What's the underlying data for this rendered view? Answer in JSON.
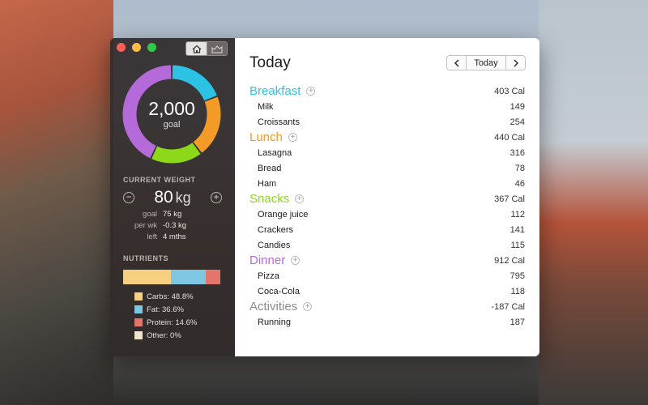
{
  "colors": {
    "breakfast": "#2cc2e4",
    "lunch": "#f39a27",
    "snacks": "#8ed81a",
    "dinner": "#b46ad8",
    "activities": "#8c8c8c",
    "carbs": "#f7cf80",
    "fat": "#7ec7e3",
    "protein": "#e3756a",
    "other": "#efe6c9"
  },
  "sidebar": {
    "toolbar": {
      "home_icon": "home-icon",
      "chart_icon": "chart-icon"
    },
    "goal": {
      "value": "2,000",
      "label": "goal"
    },
    "donut_segments": [
      {
        "meal": "breakfast",
        "calories": 403,
        "color": "#2cc2e4"
      },
      {
        "meal": "lunch",
        "calories": 440,
        "color": "#f39a27"
      },
      {
        "meal": "snacks",
        "calories": 367,
        "color": "#8ed81a"
      },
      {
        "meal": "dinner",
        "calories": 912,
        "color": "#b46ad8"
      }
    ],
    "weight": {
      "title": "CURRENT WEIGHT",
      "value": "80",
      "unit": "kg",
      "stats": [
        {
          "label": "goal",
          "value": "75 kg"
        },
        {
          "label": "per wk",
          "value": "-0.3 kg"
        },
        {
          "label": "left",
          "value": "4 mths"
        }
      ]
    },
    "nutrients": {
      "title": "NUTRIENTS",
      "items": [
        {
          "label": "Carbs: 48.8%",
          "percent": 48.8,
          "color": "#f7cf80"
        },
        {
          "label": "Fat: 36.6%",
          "percent": 36.6,
          "color": "#7ec7e3"
        },
        {
          "label": "Protein: 14.6%",
          "percent": 14.6,
          "color": "#e3756a"
        },
        {
          "label": "Other: 0%",
          "percent": 0,
          "color": "#efe6c9"
        }
      ]
    }
  },
  "main": {
    "title": "Today",
    "nav": {
      "prev": "‹",
      "today": "Today",
      "next": "›"
    },
    "meals": [
      {
        "name": "Breakfast",
        "total": "403 Cal",
        "color": "#2cc2e4",
        "items": [
          {
            "name": "Milk",
            "cal": "149"
          },
          {
            "name": "Croissants",
            "cal": "254"
          }
        ]
      },
      {
        "name": "Lunch",
        "total": "440 Cal",
        "color": "#f39a27",
        "items": [
          {
            "name": "Lasagna",
            "cal": "316"
          },
          {
            "name": "Bread",
            "cal": "78"
          },
          {
            "name": "Ham",
            "cal": "46"
          }
        ]
      },
      {
        "name": "Snacks",
        "total": "367 Cal",
        "color": "#8ed81a",
        "items": [
          {
            "name": "Orange juice",
            "cal": "112"
          },
          {
            "name": "Crackers",
            "cal": "141"
          },
          {
            "name": "Candies",
            "cal": "115"
          }
        ]
      },
      {
        "name": "Dinner",
        "total": "912 Cal",
        "color": "#b46ad8",
        "items": [
          {
            "name": "Pizza",
            "cal": "795"
          },
          {
            "name": "Coca-Cola",
            "cal": "118"
          }
        ]
      },
      {
        "name": "Activities",
        "total": "-187 Cal",
        "color": "#8c8c8c",
        "items": [
          {
            "name": "Running",
            "cal": "187"
          }
        ]
      }
    ]
  }
}
